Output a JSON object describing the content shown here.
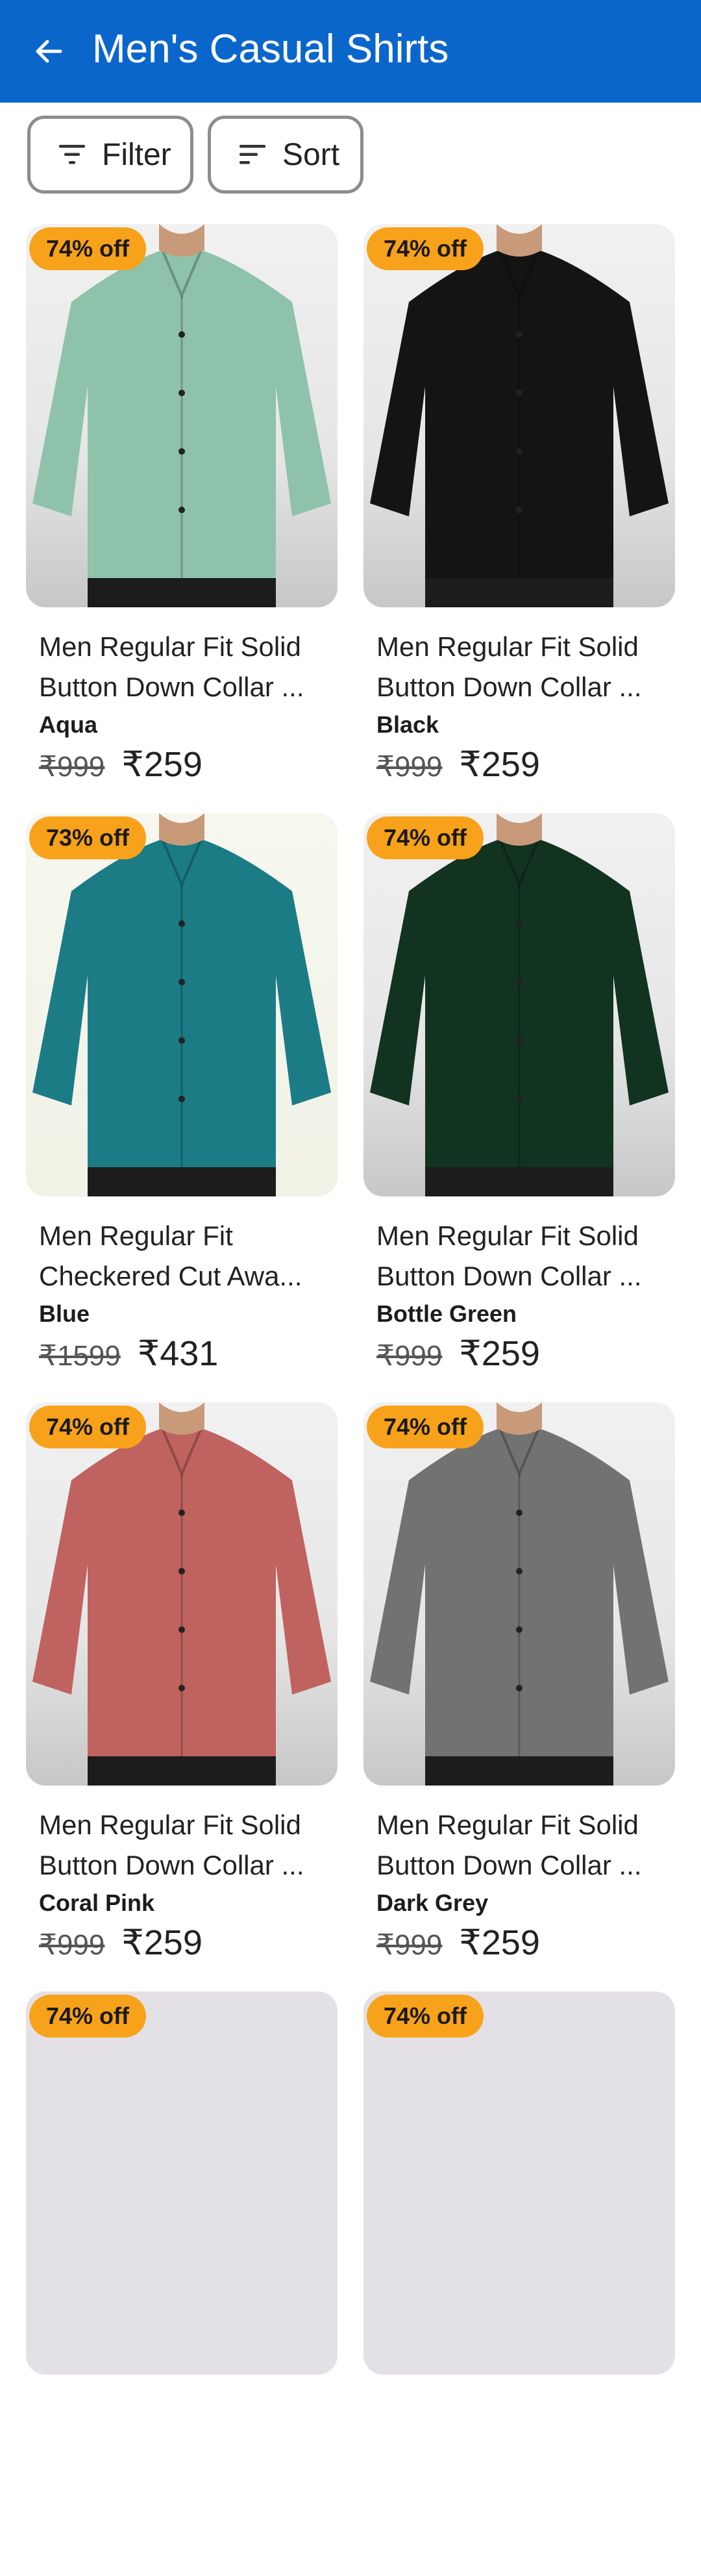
{
  "appbar": {
    "title": "Men's Casual Shirts",
    "back_icon": "arrow-left-icon"
  },
  "toolbar": {
    "filter_label": "Filter",
    "filter_icon": "filter-lines-icon",
    "sort_label": "Sort",
    "sort_icon": "sort-lines-icon"
  },
  "colors": {
    "appbar": "#0b66cc",
    "badge": "#f7a21a",
    "chip_border": "#8d8d8d"
  },
  "products": [
    {
      "discount": "74% off",
      "name": "Men Regular Fit Solid Button Down Collar ...",
      "color": "Aqua",
      "mrp": "₹999",
      "price": "₹259",
      "shirt_color": "#8fc2aa"
    },
    {
      "discount": "74% off",
      "name": "Men Regular Fit Solid Button Down Collar ...",
      "color": "Black",
      "mrp": "₹999",
      "price": "₹259",
      "shirt_color": "#141414"
    },
    {
      "discount": "73% off",
      "name": "Men Regular Fit Checkered Cut Awa...",
      "color": "Blue",
      "mrp": "₹1599",
      "price": "₹431",
      "shirt_color": "#1b7c86"
    },
    {
      "discount": "74% off",
      "name": "Men Regular Fit Solid Button Down Collar ...",
      "color": "Bottle Green",
      "mrp": "₹999",
      "price": "₹259",
      "shirt_color": "#12331f"
    },
    {
      "discount": "74% off",
      "name": "Men Regular Fit Solid Button Down Collar ...",
      "color": "Coral Pink",
      "mrp": "₹999",
      "price": "₹259",
      "shirt_color": "#c0625f"
    },
    {
      "discount": "74% off",
      "name": "Men Regular Fit Solid Button Down Collar ...",
      "color": "Dark Grey",
      "mrp": "₹999",
      "price": "₹259",
      "shirt_color": "#727272"
    },
    {
      "discount": "74% off"
    },
    {
      "discount": "74% off"
    }
  ]
}
